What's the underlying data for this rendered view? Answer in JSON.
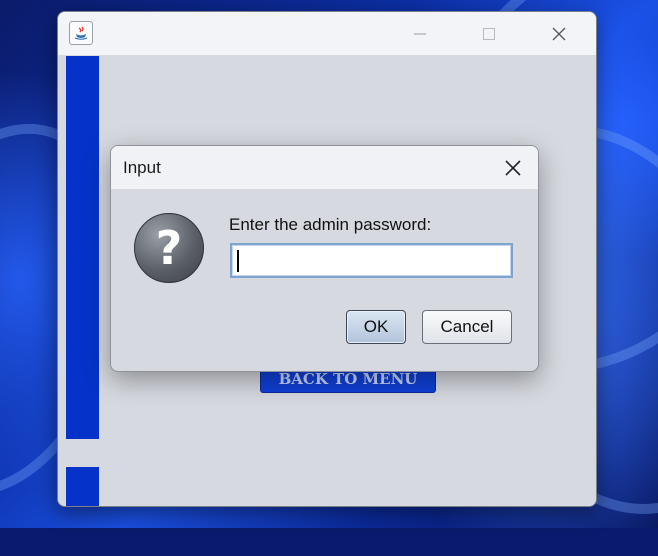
{
  "app_window": {
    "titlebar": {
      "icon": "java-app-icon",
      "minimize_icon": "minimize-icon",
      "maximize_icon": "maximize-icon",
      "close_icon": "close-icon"
    },
    "back_button_label": "BACK TO MENU",
    "accent_color": "#0533c9"
  },
  "dialog": {
    "title": "Input",
    "close_icon": "close-icon",
    "message_icon": "question-icon",
    "prompt": "Enter the admin password:",
    "password_value": "",
    "ok_label": "OK",
    "cancel_label": "Cancel"
  }
}
